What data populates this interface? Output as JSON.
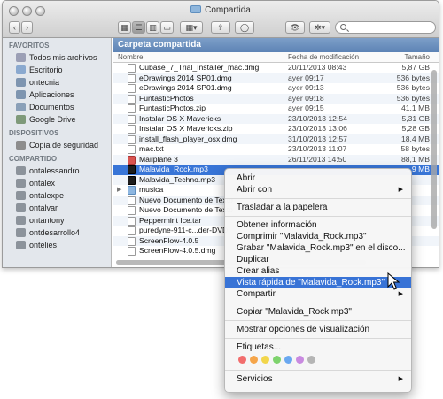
{
  "window": {
    "title": "Compartida",
    "toolbar_action_icon": "gear-icon"
  },
  "sidebar": {
    "sections": [
      {
        "heading": "FAVORITOS",
        "items": [
          {
            "label": "Todos mis archivos",
            "icon": "all-files-icon"
          },
          {
            "label": "Escritorio",
            "icon": "desktop-icon"
          },
          {
            "label": "ontecnia",
            "icon": "home-icon"
          },
          {
            "label": "Aplicaciones",
            "icon": "applications-icon"
          },
          {
            "label": "Documentos",
            "icon": "documents-icon"
          },
          {
            "label": "Google Drive",
            "icon": "google-drive-icon"
          }
        ]
      },
      {
        "heading": "DISPOSITIVOS",
        "items": [
          {
            "label": "Copia de seguridad",
            "icon": "disk-icon"
          }
        ]
      },
      {
        "heading": "COMPARTIDO",
        "items": [
          {
            "label": "ontalessandro",
            "icon": "computer-icon"
          },
          {
            "label": "ontalex",
            "icon": "computer-icon"
          },
          {
            "label": "ontalexpe",
            "icon": "computer-icon"
          },
          {
            "label": "ontalvar",
            "icon": "computer-icon"
          },
          {
            "label": "ontantony",
            "icon": "computer-icon"
          },
          {
            "label": "ontdesarrollo4",
            "icon": "computer-icon"
          },
          {
            "label": "ontelies",
            "icon": "computer-icon"
          }
        ]
      }
    ]
  },
  "content": {
    "path_title": "Carpeta compartida",
    "columns": {
      "name": "Nombre",
      "date": "Fecha de modificación",
      "size": "Tamaño"
    },
    "files": [
      {
        "name": "Cubase_7_Trial_Installer_mac.dmg",
        "date": "20/11/2013 08:43",
        "size": "5,87 GB",
        "icon": "file"
      },
      {
        "name": "eDrawings 2014 SP01.dmg",
        "date": "ayer 09:17",
        "size": "536 bytes",
        "icon": "file"
      },
      {
        "name": "eDrawings 2014 SP01.dmg",
        "date": "ayer 09:13",
        "size": "536 bytes",
        "icon": "file"
      },
      {
        "name": "FuntasticPhotos",
        "date": "ayer 09:18",
        "size": "536 bytes",
        "icon": "file"
      },
      {
        "name": "FuntasticPhotos.zip",
        "date": "ayer 09:15",
        "size": "41,1 MB",
        "icon": "file"
      },
      {
        "name": "Instalar OS X Mavericks",
        "date": "23/10/2013 12:54",
        "size": "5,31 GB",
        "icon": "file"
      },
      {
        "name": "Instalar OS X Mavericks.zip",
        "date": "23/10/2013 13:06",
        "size": "5,28 GB",
        "icon": "file"
      },
      {
        "name": "install_flash_player_osx.dmg",
        "date": "31/10/2013 12:57",
        "size": "18,4 MB",
        "icon": "file"
      },
      {
        "name": "mac.txt",
        "date": "23/10/2013 11:07",
        "size": "58 bytes",
        "icon": "file"
      },
      {
        "name": "Mailplane 3",
        "date": "26/11/2013 14:50",
        "size": "88,1 MB",
        "icon": "app"
      },
      {
        "name": "Malavida_Rock.mp3",
        "date": "",
        "size": "...9 MB",
        "icon": "mp3",
        "selected": true
      },
      {
        "name": "Malavida_Techno.mp3",
        "date": "",
        "size": "",
        "icon": "mp3"
      },
      {
        "name": "musica",
        "date": "",
        "size": "",
        "icon": "folder",
        "folder": true
      },
      {
        "name": "Nuevo Documento de Texto",
        "date": "",
        "size": "",
        "icon": "file"
      },
      {
        "name": "Nuevo Documento de Texto",
        "date": "",
        "size": "",
        "icon": "file"
      },
      {
        "name": "Peppermint Ice.tar",
        "date": "",
        "size": "",
        "icon": "file"
      },
      {
        "name": "puredyne-911-c...der-DVD",
        "date": "",
        "size": "",
        "icon": "file"
      },
      {
        "name": "ScreenFlow-4.0.5",
        "date": "",
        "size": "",
        "icon": "file"
      },
      {
        "name": "ScreenFlow-4.0.5.dmg",
        "date": "",
        "size": "",
        "icon": "file"
      }
    ]
  },
  "context_menu": {
    "items": [
      {
        "label": "Abrir"
      },
      {
        "label": "Abrir con",
        "submenu": true
      },
      {
        "sep": true
      },
      {
        "label": "Trasladar a la papelera"
      },
      {
        "sep": true
      },
      {
        "label": "Obtener información"
      },
      {
        "label": "Comprimir \"Malavida_Rock.mp3\""
      },
      {
        "label": "Grabar \"Malavida_Rock.mp3\" en el disco..."
      },
      {
        "label": "Duplicar"
      },
      {
        "label": "Crear alias"
      },
      {
        "label": "Vista rápida de \"Malavida_Rock.mp3\"",
        "highlighted": true
      },
      {
        "label": "Compartir",
        "submenu": true
      },
      {
        "sep": true
      },
      {
        "label": "Copiar \"Malavida_Rock.mp3\""
      },
      {
        "sep": true
      },
      {
        "label": "Mostrar opciones de visualización"
      },
      {
        "sep": true
      },
      {
        "label": "Etiquetas..."
      },
      {
        "tags": true
      },
      {
        "sep": true
      },
      {
        "label": "Servicios",
        "submenu": true
      }
    ],
    "tag_colors": [
      "#f26d6d",
      "#f5a54a",
      "#f2d64b",
      "#7ed36d",
      "#6aa8f0",
      "#c98ae0",
      "#b5b5b5"
    ]
  },
  "colors": {
    "selection": "#3875d7",
    "menu_highlight": "#3873d6",
    "path_bar": "#6a8fbf"
  }
}
